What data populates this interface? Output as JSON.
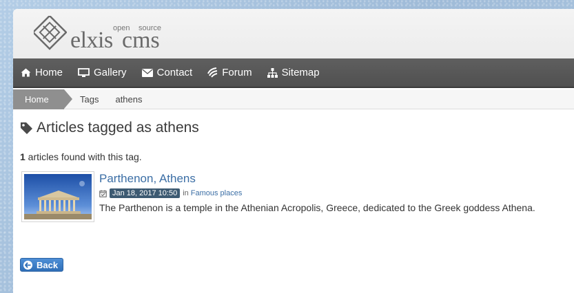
{
  "header": {
    "logo_main": "elxis",
    "logo_cms": "cms",
    "logo_open": "open",
    "logo_source": "source"
  },
  "nav": {
    "items": [
      {
        "label": "Home",
        "icon": "home-icon"
      },
      {
        "label": "Gallery",
        "icon": "monitor-icon"
      },
      {
        "label": "Contact",
        "icon": "envelope-icon"
      },
      {
        "label": "Forum",
        "icon": "forum-icon"
      },
      {
        "label": "Sitemap",
        "icon": "sitemap-icon"
      }
    ]
  },
  "breadcrumb": {
    "home": "Home",
    "tags": "Tags",
    "current": "athens"
  },
  "main": {
    "title": "Articles tagged as athens",
    "count": "1",
    "count_text": " articles found with this tag."
  },
  "article": {
    "title": "Parthenon, Athens",
    "date": "Jan 18, 2017 10:50",
    "in_label": "in",
    "category": "Famous places",
    "description": "The Parthenon is a temple in the Athenian Acropolis, Greece, dedicated to the Greek goddess Athena."
  },
  "back_button": {
    "label": "Back"
  },
  "colors": {
    "navbar": "#555555",
    "link": "#3b6ea5",
    "date_badge": "#3d5a72",
    "back_button": "#3a7bc8"
  }
}
